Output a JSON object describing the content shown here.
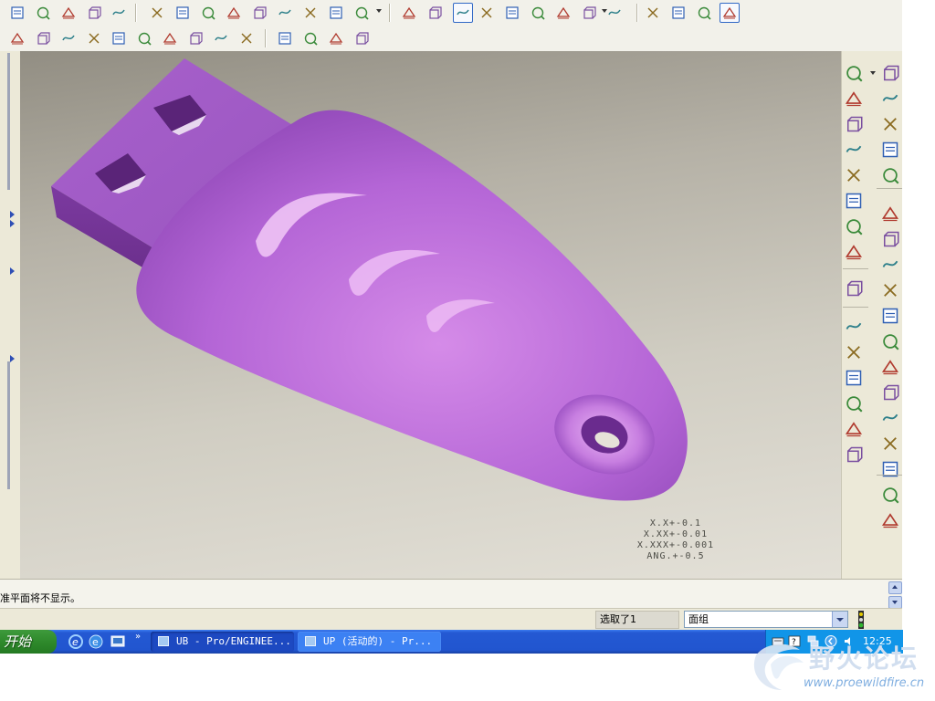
{
  "colors": {
    "model": "#b86ad8",
    "viewport_top": "#928e83",
    "viewport_bottom": "#e3e0d7",
    "taskbar": "#2155cf",
    "start_button": "#2f8a2c",
    "tray": "#1195e8",
    "highlight": "#3169c6"
  },
  "toolbar_row1": [
    "open-file-icon",
    "new-file-icon",
    "open-folder-icon",
    "save-icon",
    "print-icon",
    "undo-icon",
    "redo-icon",
    "cut-icon",
    "copy-icon",
    "paste-icon",
    "paste-special-icon",
    "regenerate-icon",
    "find-icon",
    "select-box-icon",
    "spin-center-icon",
    "orient-icon",
    "datum-display-icon",
    "zoom-in-icon",
    "zoom-out-icon",
    "refit-icon",
    "reorient-icon",
    "annotation-icon",
    "layers-icon",
    "wireframe-icon",
    "hidden-line-icon",
    "no-hidden-icon",
    "shading-icon"
  ],
  "toolbar_row2": [
    "draft-check-icon",
    "section-icon",
    "measure-icon",
    "curvature-icon",
    "surface-analysis-icon",
    "graph-icon",
    "reflection-icon",
    "shaded-curvature-icon",
    "dihedral-icon",
    "saved-analysis-icon",
    "datum-plane-display-icon",
    "datum-axis-display-icon",
    "datum-point-display-icon",
    "coordinate-system-display-icon"
  ],
  "right_toolbar_col1": [
    "datum-point-icon",
    "datum-axis-icon",
    "sketched-curve-icon",
    "datum-plane-icon",
    "axis-icon",
    "curve-icon",
    "coordinate-point-icon",
    "analysis-feature-icon",
    "sketch-icon",
    "hole-icon",
    "shell-icon",
    "rib-icon",
    "draft-icon",
    "round-icon",
    "chamfer-icon"
  ],
  "right_toolbar_col2": [
    "copy-feature-icon",
    "mirror-icon",
    "merge-icon",
    "trim-icon",
    "extend-icon",
    "offset-icon",
    "intersect-icon",
    "project-icon",
    "solidify-icon",
    "thicken-icon",
    "fill-icon",
    "blend-icon",
    "boundary-icon",
    "style-icon",
    "extrude-icon",
    "revolve-icon",
    "add-icon",
    "cylinder-icon"
  ],
  "viewport": {
    "tolerances": [
      "X.X+-0.1",
      "X.XX+-0.01",
      "X.XXX+-0.001",
      "ANG.+-0.5"
    ]
  },
  "message": {
    "text": "准平面将不显示。"
  },
  "status": {
    "selected": "选取了1",
    "filter_value": "面组"
  },
  "taskbar": {
    "start_label": "开始",
    "quicklaunch": [
      "ie-icon",
      "ie-alt-icon",
      "desktop-icon"
    ],
    "chevron": "»",
    "tasks": [
      {
        "label": "UB - Pro/ENGINEE..."
      },
      {
        "label": "UP (活动的) - Pr..."
      }
    ],
    "tray_icons": [
      "keyboard-icon",
      "help-icon",
      "network-icon",
      "arrow-icon",
      "volume-icon"
    ],
    "clock": "12:25"
  },
  "watermark": {
    "text": "野火论坛",
    "url": "www.proewildfire.cn"
  }
}
